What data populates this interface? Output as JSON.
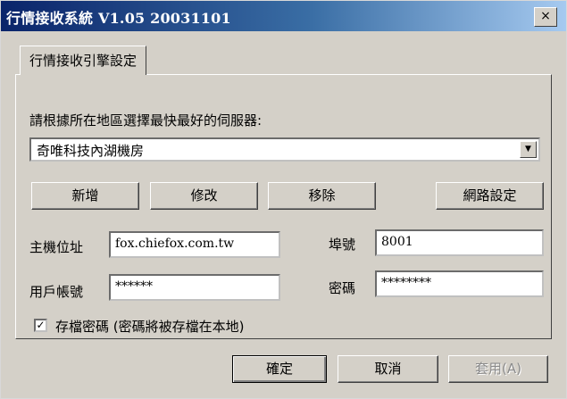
{
  "window": {
    "title": "行情接收系統 V1.05 20031101",
    "close_glyph": "×"
  },
  "tab": {
    "label": "行情接收引擎設定"
  },
  "server": {
    "prompt": "請根據所在地區選擇最快最好的伺服器:",
    "selected": "奇唯科技內湖機房",
    "arrow_glyph": "▼"
  },
  "server_buttons": {
    "add": "新增",
    "edit": "修改",
    "remove": "移除",
    "network": "網路設定"
  },
  "fields": {
    "host_label": "主機位址",
    "host_value": "fox.chiefox.com.tw",
    "port_label": "埠號",
    "port_value": "8001",
    "account_label": "用戶帳號",
    "account_value": "******",
    "password_label": "密碼",
    "password_value": "********"
  },
  "save_password": {
    "checked": true,
    "check_glyph": "✓",
    "label": "存檔密碼 (密碼將被存檔在本地)"
  },
  "footer": {
    "ok": "確定",
    "cancel": "取消",
    "apply": "套用(A)"
  }
}
